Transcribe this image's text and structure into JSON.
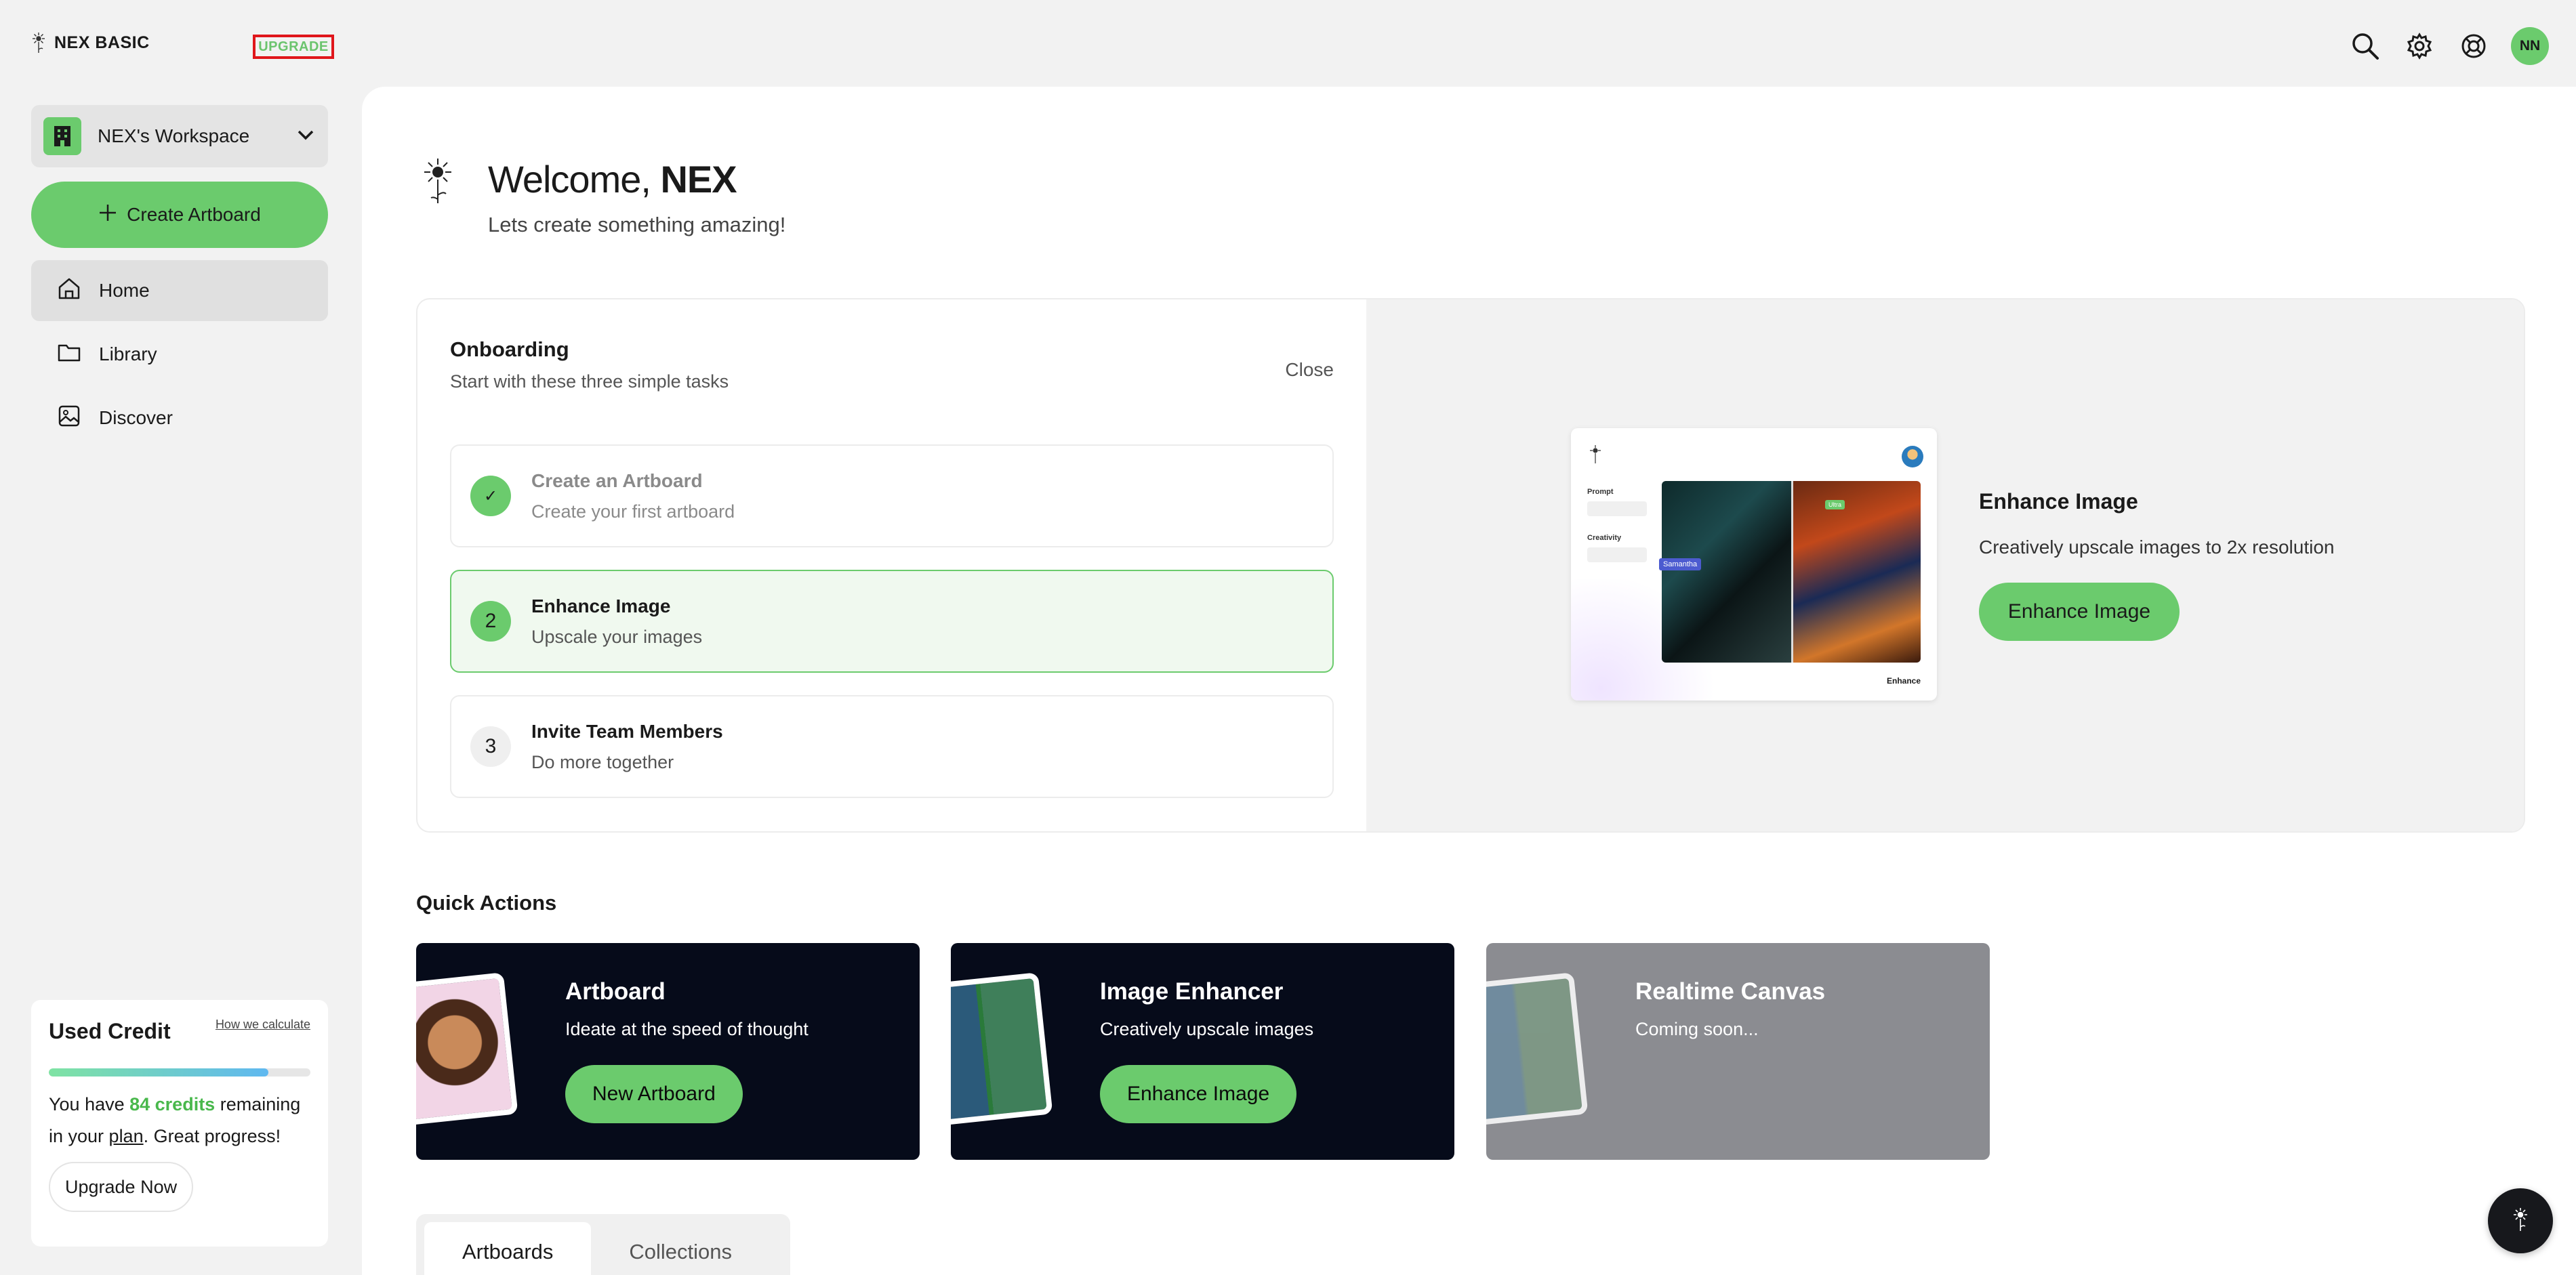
{
  "brand": {
    "name": "NEX BASIC",
    "tag": "UPGRADE"
  },
  "user": {
    "initials": "NN"
  },
  "colors": {
    "accent": "#6bcb6d",
    "dark_card": "#060b1a",
    "disabled_card": "#8b8c91",
    "highlight_border": "#e0161b"
  },
  "topbar": {
    "icons": [
      "search-icon",
      "gear-icon",
      "help-lifebuoy-icon"
    ]
  },
  "sidebar": {
    "workspace": "NEX's Workspace",
    "create": "Create Artboard",
    "items": [
      {
        "label": "Home",
        "icon": "home-icon",
        "active": true
      },
      {
        "label": "Library",
        "icon": "folder-icon",
        "active": false
      },
      {
        "label": "Discover",
        "icon": "image-icon",
        "active": false
      }
    ]
  },
  "credit": {
    "title": "Used Credit",
    "how": "How we calculate",
    "progress": 0.84,
    "text_before": "You have ",
    "credits": "84 credits",
    "text_after": " remaining",
    "text_line2_pre": "in your ",
    "plan": "plan",
    "text_line2_post": ". Great progress!",
    "upgrade": "Upgrade Now"
  },
  "welcome": {
    "greeting": "Welcome, ",
    "name": "NEX",
    "subtitle": "Lets create something amazing!"
  },
  "onboarding": {
    "title": "Onboarding",
    "subtitle": "Start with these three simple tasks",
    "close": "Close",
    "tasks": [
      {
        "badge": "✓",
        "title": "Create an Artboard",
        "desc": "Create your first artboard",
        "state": "done"
      },
      {
        "badge": "2",
        "title": "Enhance Image",
        "desc": "Upscale your images",
        "state": "active"
      },
      {
        "badge": "3",
        "title": "Invite Team Members",
        "desc": "Do more together",
        "state": "todo"
      }
    ],
    "preview": {
      "label_prompt": "Prompt",
      "label_creativity": "Creativity",
      "tag": "Samantha",
      "tag2": "Ultra",
      "footer": "Enhance"
    },
    "feature": {
      "title": "Enhance Image",
      "desc": "Creatively upscale images to 2x resolution",
      "button": "Enhance Image"
    }
  },
  "quick_actions": {
    "heading": "Quick Actions",
    "cards": [
      {
        "title": "Artboard",
        "desc": "Ideate at the speed of thought",
        "button": "New Artboard"
      },
      {
        "title": "Image Enhancer",
        "desc": "Creatively upscale images",
        "button": "Enhance Image"
      },
      {
        "title": "Realtime Canvas",
        "desc": "Coming soon..."
      }
    ]
  },
  "tabs": [
    {
      "label": "Artboards",
      "active": true
    },
    {
      "label": "Collections",
      "active": false
    }
  ]
}
